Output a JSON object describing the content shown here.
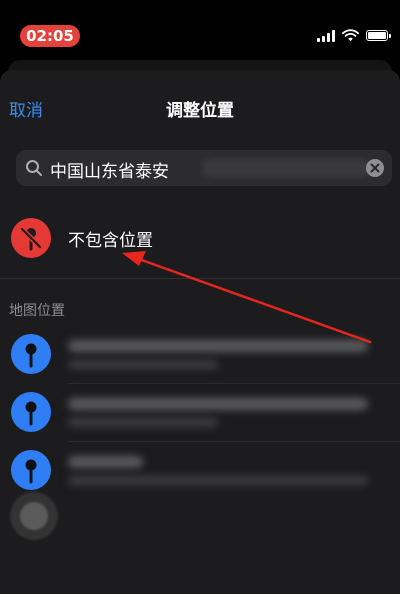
{
  "status_bar": {
    "time": "02:05",
    "icons": [
      "cellular-signal-icon",
      "wifi-icon",
      "battery-icon"
    ]
  },
  "nav": {
    "cancel_label": "取消",
    "title": "调整位置"
  },
  "search": {
    "value": "中国山东省泰安",
    "icon": "search-icon",
    "clear_icon": "clear-icon"
  },
  "no_location": {
    "label": "不包含位置",
    "icon": "location-off-icon"
  },
  "map_section": {
    "header": "地图位置",
    "items": [
      {
        "icon": "map-pin-icon"
      },
      {
        "icon": "map-pin-icon"
      },
      {
        "icon": "map-pin-icon"
      }
    ]
  },
  "colors": {
    "accent": "#3d8cf2",
    "time_pill": "#e4433d",
    "no_location_circle": "#e53935",
    "pin_circle": "#2f7ef5",
    "annotation_arrow": "#e8261e",
    "sheet_background": "#1c1c1e"
  }
}
